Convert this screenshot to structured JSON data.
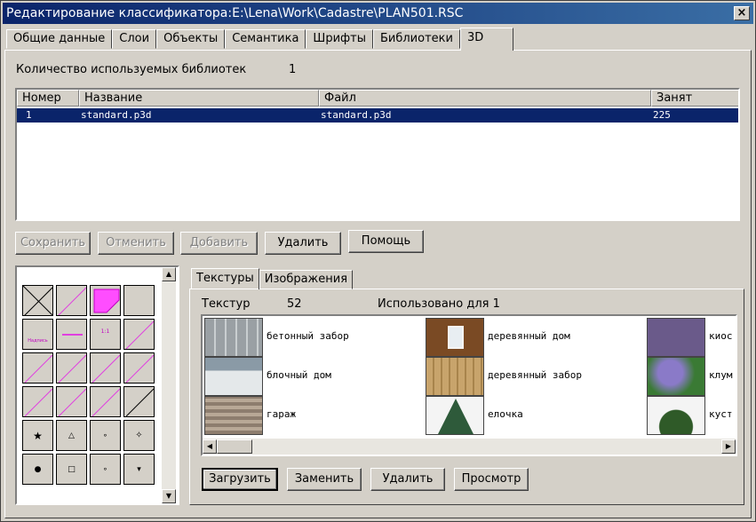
{
  "window": {
    "title": "Редактирование классификатора:E:\\Lena\\Work\\Cadastre\\PLAN501.RSC",
    "close_glyph": "×"
  },
  "tabs": [
    {
      "label": "Общие данные"
    },
    {
      "label": "Слои"
    },
    {
      "label": "Объекты"
    },
    {
      "label": "Семантика"
    },
    {
      "label": "Шрифты"
    },
    {
      "label": "Библиотеки"
    },
    {
      "label": "3D"
    }
  ],
  "libraries": {
    "count_label": "Количество используемых библиотек",
    "count_value": "1",
    "columns": [
      "Номер",
      "Название",
      "Файл",
      "Занят"
    ],
    "rows": [
      {
        "num": "1",
        "name": "standard.p3d",
        "file": "standard.p3d",
        "used": "225"
      }
    ]
  },
  "library_buttons": {
    "save": "Сохранить",
    "cancel": "Отменить",
    "add": "Добавить",
    "delete": "Удалить",
    "help": "Помощь"
  },
  "palette": {
    "label_text": "Надпись",
    "size_text": "1:1"
  },
  "inner_tabs": [
    {
      "label": "Текстуры"
    },
    {
      "label": "Изображения"
    }
  ],
  "textures": {
    "count_label": "Текстур",
    "count_value": "52",
    "used_label": "Использовано для 1",
    "items": [
      {
        "name": "бетонный забор",
        "icon": "concrete-fence-thumbnail"
      },
      {
        "name": "блочный дом",
        "icon": "block-house-thumbnail"
      },
      {
        "name": "гараж",
        "icon": "garage-thumbnail"
      },
      {
        "name": "деревянный дом",
        "icon": "wooden-house-thumbnail"
      },
      {
        "name": "деревянный забор",
        "icon": "wooden-fence-thumbnail"
      },
      {
        "name": "елочка",
        "icon": "fir-tree-thumbnail"
      },
      {
        "name": "киос",
        "icon": "kiosk-thumbnail"
      },
      {
        "name": "клум",
        "icon": "flowerbed-thumbnail"
      },
      {
        "name": "куст",
        "icon": "bush-thumbnail"
      }
    ]
  },
  "texture_buttons": {
    "load": "Загрузить",
    "replace": "Заменить",
    "delete": "Удалить",
    "view": "Просмотр"
  }
}
